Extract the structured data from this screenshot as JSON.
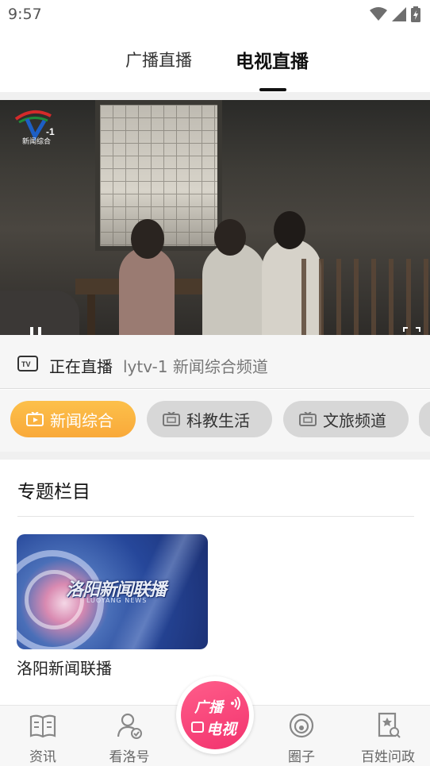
{
  "status_bar": {
    "time": "9:57"
  },
  "top_tabs": {
    "radio": "广播直播",
    "tv": "电视直播",
    "active": "tv"
  },
  "video": {
    "channel_logo": "LYTV-1",
    "logo_caption": "新闻综合"
  },
  "live_info": {
    "label": "正在直播",
    "channel": "lytv-1 新闻综合频道"
  },
  "channels": [
    {
      "label": "新闻综合",
      "active": true
    },
    {
      "label": "科教生活",
      "active": false
    },
    {
      "label": "文旅频道",
      "active": false
    }
  ],
  "topics": {
    "title": "专题栏目",
    "items": [
      {
        "title": "洛阳新闻联播",
        "logo_text": "洛阳新闻联播",
        "logo_en": "LUOYANG NEWS"
      }
    ]
  },
  "bottom_nav": {
    "items": [
      {
        "label": "资讯",
        "icon": "book-icon"
      },
      {
        "label": "看洛号",
        "icon": "user-check-icon"
      },
      {
        "label": "圈子",
        "icon": "circle-icon"
      },
      {
        "label": "百姓问政",
        "icon": "report-icon"
      }
    ],
    "center": {
      "top": "广播",
      "bottom": "电视"
    }
  },
  "colors": {
    "accent": "#F9A93A",
    "center_button": "#F2336E",
    "chip_inactive": "#D7D7D7"
  }
}
